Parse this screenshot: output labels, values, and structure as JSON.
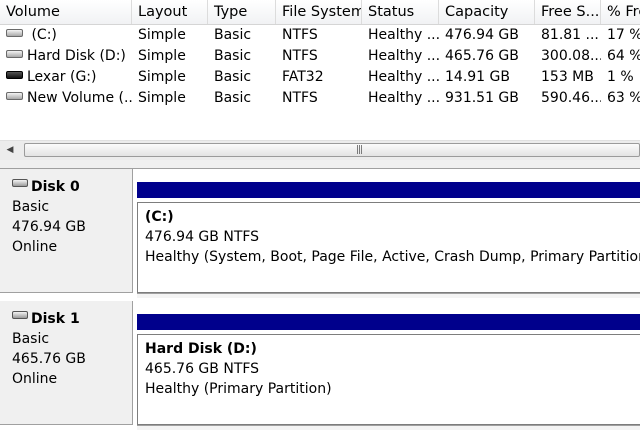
{
  "volume_list": {
    "columns": [
      "Volume",
      "Layout",
      "Type",
      "File System",
      "Status",
      "Capacity",
      "Free S...",
      "% Fre"
    ],
    "rows": [
      {
        "icon": "drive-icon",
        "volume": " (C:)",
        "layout": "Simple",
        "type": "Basic",
        "fs": "NTFS",
        "status": "Healthy ...",
        "capacity": "476.94 GB",
        "free": "81.81 ...",
        "pct": "17 %"
      },
      {
        "icon": "drive-icon",
        "volume": "Hard Disk (D:)",
        "layout": "Simple",
        "type": "Basic",
        "fs": "NTFS",
        "status": "Healthy ...",
        "capacity": "465.76 GB",
        "free": "300.08...",
        "pct": "64 %"
      },
      {
        "icon": "usb-drive-icon",
        "volume": "Lexar (G:)",
        "layout": "Simple",
        "type": "Basic",
        "fs": "FAT32",
        "status": "Healthy ...",
        "capacity": "14.91 GB",
        "free": "153 MB",
        "pct": "1 %"
      },
      {
        "icon": "drive-icon",
        "volume": "New Volume (...",
        "layout": "Simple",
        "type": "Basic",
        "fs": "NTFS",
        "status": "Healthy ...",
        "capacity": "931.51 GB",
        "free": "590.46...",
        "pct": "63 %"
      }
    ]
  },
  "scrollbar": {
    "left_arrow": "◀",
    "grip": "|||"
  },
  "disks": [
    {
      "title": "Disk 0",
      "type": "Basic",
      "size": "476.94 GB",
      "state": "Online",
      "partition": {
        "name": " (C:)",
        "size_fs": "476.94 GB NTFS",
        "status": "Healthy (System, Boot, Page File, Active, Crash Dump, Primary Partition)"
      }
    },
    {
      "title": "Disk 1",
      "type": "Basic",
      "size": "465.76 GB",
      "state": "Online",
      "partition": {
        "name": "Hard Disk  (D:)",
        "size_fs": "465.76 GB NTFS",
        "status": "Healthy (Primary Partition)"
      }
    }
  ],
  "colors": {
    "partition_bar": "#00008c",
    "panel_bg": "#f0f0f0"
  }
}
